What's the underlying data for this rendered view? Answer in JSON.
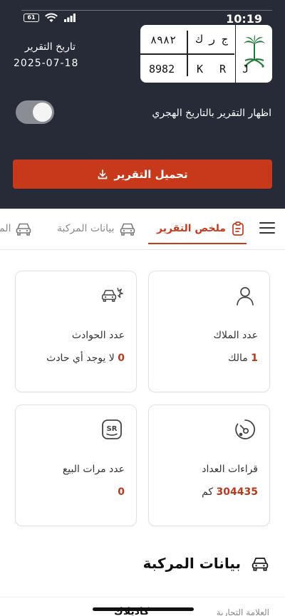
{
  "status_bar": {
    "time": "10:19",
    "battery": "61"
  },
  "header": {
    "report_date_label": "تاريخ التقرير",
    "report_date_value": "2025-07-18",
    "plate": {
      "arabic_letters": "ج ر ك",
      "arabic_number": "٨٩٨٢",
      "latin_letters": "K R J",
      "latin_number": "8982"
    },
    "hijri_toggle_label": "اظهار التقرير بالتاريخ الهجري",
    "hijri_toggle_on": false,
    "download_button_label": "تحميل التقرير"
  },
  "tabs": [
    {
      "label": "ملخص التقرير",
      "icon": "clipboard-icon",
      "active": true
    },
    {
      "label": "بيانات المركبة",
      "icon": "car-icon",
      "active": false
    },
    {
      "label": "المو",
      "icon": "car-icon",
      "active": false
    }
  ],
  "cards": [
    {
      "title": "عدد الملاك",
      "value_number": "1",
      "value_text": "مالك",
      "icon": "person-icon"
    },
    {
      "title": "عدد الحوادث",
      "value_number": "0",
      "value_text": "لا يوجد أي حادث",
      "icon": "car-crash-icon"
    },
    {
      "title": "قراءات العداد",
      "value_number": "304435",
      "value_text": "كم",
      "icon": "odometer-icon"
    },
    {
      "title": "عدد مرات البيع",
      "value_number": "0",
      "value_text": "",
      "icon": "sr-badge-icon"
    }
  ],
  "vehicle_section": {
    "title": "بيانات المركبة",
    "first_row_label": "العلامة التجارية",
    "first_row_value": "كاديلاك"
  },
  "colors": {
    "header_bg": "#262b37",
    "accent": "#c8391c",
    "value_red": "#b83a1d"
  }
}
